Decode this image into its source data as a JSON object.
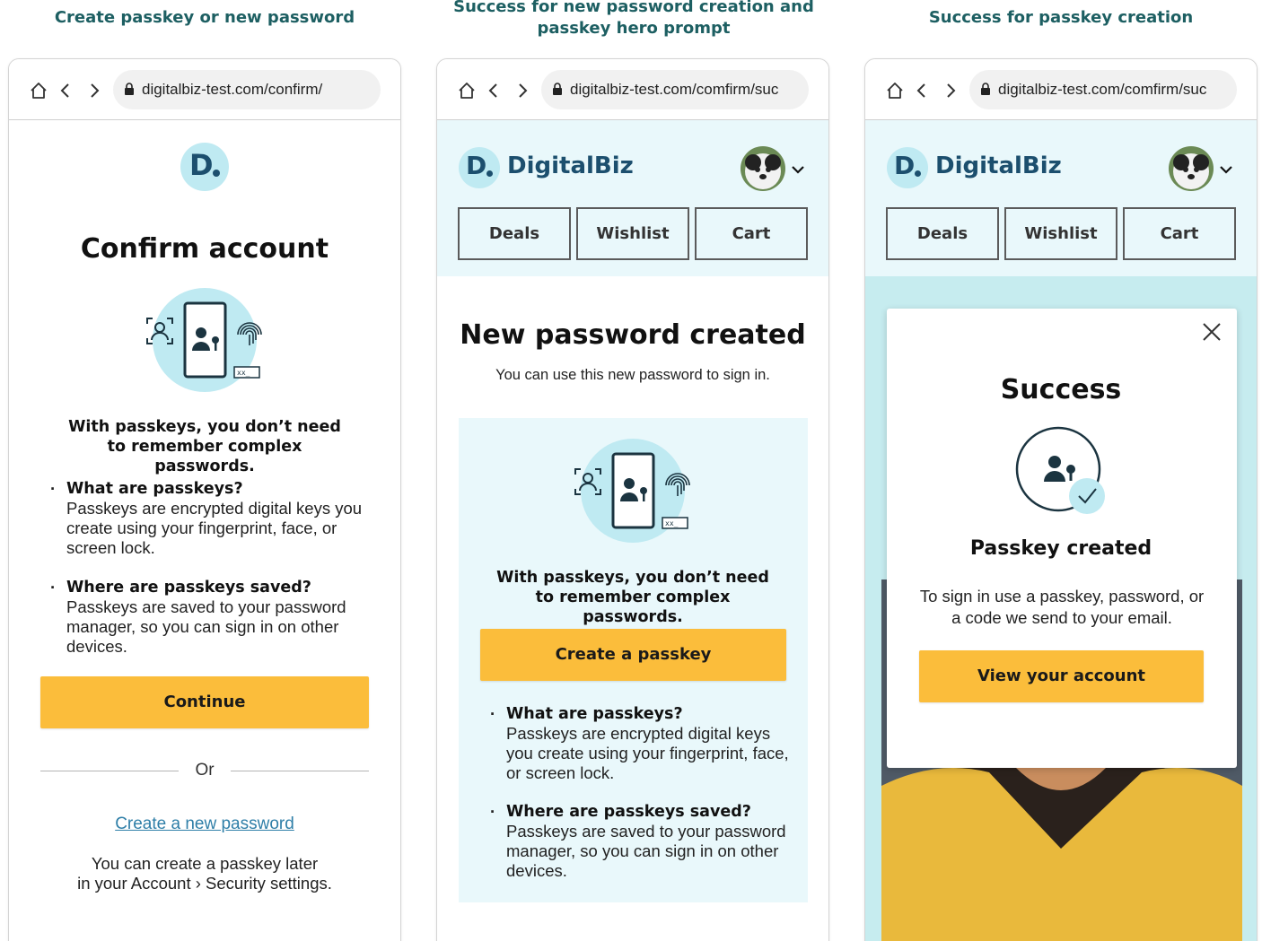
{
  "captions": [
    "Create passkey or new password",
    "Success for new password creation and passkey hero prompt",
    "Success for passkey creation"
  ],
  "screens": [
    {
      "url": "digitalbiz-test.com/confirm/",
      "logo_letter": "D",
      "title": "Confirm account",
      "intro": "With passkeys, you don’t need to remember complex passwords.",
      "faq": [
        {
          "q": "What are passkeys?",
          "a": "Passkeys are encrypted digital keys you create using your fingerprint, face, or screen lock."
        },
        {
          "q": "Where are passkeys saved?",
          "a": "Passkeys are saved to your password manager, so you can sign in on other devices."
        }
      ],
      "continue_label": "Continue",
      "or_label": "Or",
      "create_password_link": "Create a new password",
      "footer_line1": "You can create a passkey later",
      "footer_line2": "in your Account › Security settings."
    },
    {
      "url": "digitalbiz-test.com/comfirm/suc",
      "logo_letter": "D",
      "brand": "DigitalBiz",
      "nav": [
        "Deals",
        "Wishlist",
        "Cart"
      ],
      "title": "New password created",
      "subtitle": "You can use this new password to sign in.",
      "intro": "With passkeys, you don’t need to remember complex passwords.",
      "create_passkey_label": "Create a passkey",
      "faq": [
        {
          "q": "What are passkeys?",
          "a": "Passkeys are encrypted digital keys you create using your fingerprint, face, or screen lock."
        },
        {
          "q": "Where are passkeys saved?",
          "a": "Passkeys are saved to your password manager, so you can sign in on other devices."
        }
      ]
    },
    {
      "url": "digitalbiz-test.com/comfirm/suc",
      "logo_letter": "D",
      "brand": "DigitalBiz",
      "nav": [
        "Deals",
        "Wishlist",
        "Cart"
      ],
      "modal_title": "Success",
      "passkey_created": "Passkey created",
      "signin_text": "To sign in use a passkey, password, or a code we send to your email.",
      "view_account_label": "View your account"
    }
  ],
  "colors": {
    "accent_yellow": "#fbbd3b",
    "teal_caption": "#1d5f62",
    "brand_navy": "#1c4f6e",
    "light_cyan": "#e9f8fb",
    "logo_cyan": "#bfeaf2",
    "link_blue": "#2f7fa8"
  },
  "icons": [
    "home-icon",
    "back-icon",
    "forward-icon",
    "lock-icon",
    "face-scan-icon",
    "phone-user-key-icon",
    "fingerprint-icon",
    "password-field-icon",
    "chevron-down-icon",
    "close-icon",
    "checkmark-icon"
  ]
}
